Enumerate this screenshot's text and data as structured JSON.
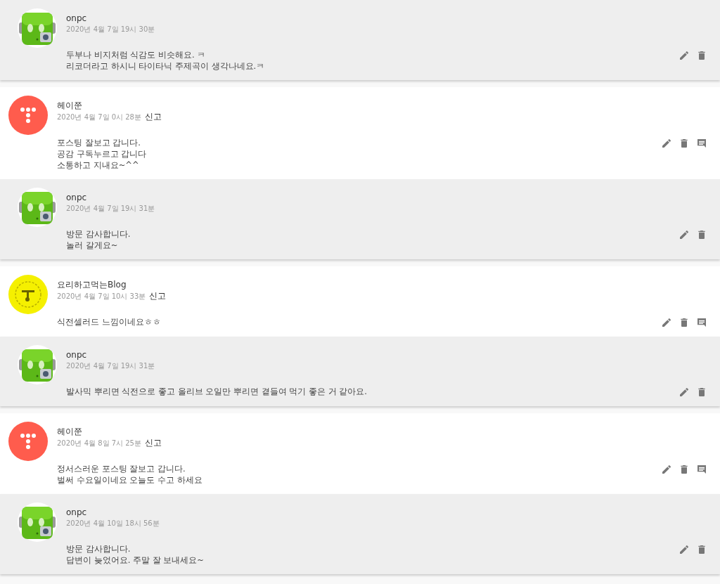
{
  "comments": [
    {
      "kind": "reply",
      "avatar": {
        "kind": "robot"
      },
      "author": "onpc",
      "date": "2020년 4월 7일 19시 30분",
      "lines": [
        "두부나 비지처럼 식감도 비슷해요. ㅋ",
        "리코더라고 하시니 타이타닉 주제곡이 생각나네요.ㅋ"
      ]
    },
    {
      "kind": "comment",
      "avatar": {
        "kind": "dots"
      },
      "author": "헤이쭌",
      "date": "2020년 4월 7일 0시 28분",
      "report": "신고",
      "lines": [
        "포스팅 잘보고 갑니다.",
        "공감 구독누르고 갑니다",
        "소통하고 지내요~^^"
      ]
    },
    {
      "kind": "reply",
      "avatar": {
        "kind": "robot"
      },
      "author": "onpc",
      "date": "2020년 4월 7일 19시 31분",
      "lines": [
        "방문 감사합니다.",
        "놀러 갈게요~"
      ]
    },
    {
      "kind": "comment",
      "avatar": {
        "kind": "badge"
      },
      "author": "요리하고먹는Blog",
      "date": "2020년 4월 7일 10시 33분",
      "report": "신고",
      "lines": [
        "식전셀러드 느낌이네요ㅎㅎ"
      ]
    },
    {
      "kind": "reply",
      "avatar": {
        "kind": "robot"
      },
      "author": "onpc",
      "date": "2020년 4월 7일 19시 31분",
      "lines": [
        "발사믹 뿌리면 식전으로 좋고 올리브 오일만 뿌리면 곁들여 먹기 좋은 거 같아요."
      ]
    },
    {
      "kind": "comment",
      "avatar": {
        "kind": "dots"
      },
      "author": "헤이쭌",
      "date": "2020년 4월 8일 7시 25분",
      "report": "신고",
      "lines": [
        "정서스러운 포스팅 잘보고 갑니다.",
        "벌써 수요일이네요 오늘도 수고 하세요"
      ]
    },
    {
      "kind": "reply",
      "avatar": {
        "kind": "robot"
      },
      "author": "onpc",
      "date": "2020년 4월 10일 18시 56분",
      "lines": [
        "방문 감사합니다.",
        "답변이 늦었어요. 주말 잘 보내세요~"
      ]
    }
  ]
}
